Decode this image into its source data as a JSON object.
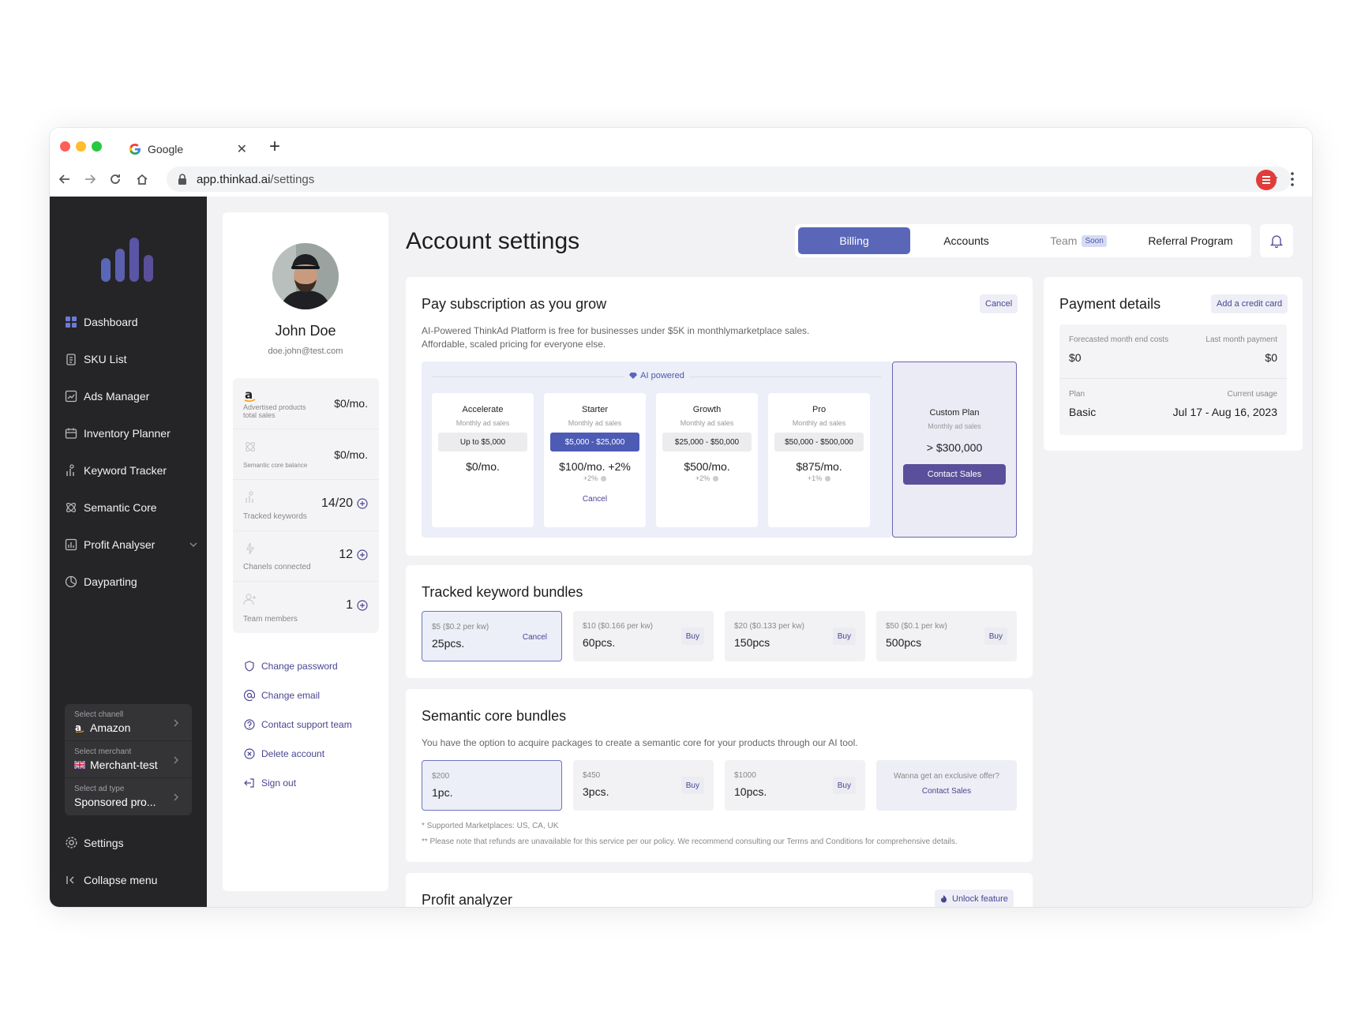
{
  "browser": {
    "tab_title": "Google",
    "url_domain": "app.thinkad.ai",
    "url_path": "/settings"
  },
  "sidebar": {
    "items": [
      {
        "label": "Dashboard",
        "icon": "dashboard-icon"
      },
      {
        "label": "SKU List",
        "icon": "clipboard-icon"
      },
      {
        "label": "Ads Manager",
        "icon": "chart-line-icon"
      },
      {
        "label": "Inventory Planner",
        "icon": "calendar-icon"
      },
      {
        "label": "Keyword Tracker",
        "icon": "keyword-icon"
      },
      {
        "label": "Semantic Core",
        "icon": "atom-icon"
      },
      {
        "label": "Profit Analyser",
        "icon": "bar-chart-icon"
      },
      {
        "label": "Dayparting",
        "icon": "clock-pie-icon"
      }
    ],
    "selectors": [
      {
        "label": "Select chanell",
        "value": "Amazon"
      },
      {
        "label": "Select merchant",
        "value": "Merchant-test"
      },
      {
        "label": "Select ad type",
        "value": "Sponsored pro..."
      }
    ],
    "settings_label": "Settings",
    "collapse_label": "Collapse menu"
  },
  "profile": {
    "name": "John Doe",
    "email": "doe.john@test.com",
    "stats": [
      {
        "label": "Advertised products total sales",
        "value": "$0/mo."
      },
      {
        "label": "Semantic core balance",
        "value": "$0/mo."
      },
      {
        "label": "Tracked keywords",
        "value": "14/20"
      },
      {
        "label": "Chanels connected",
        "value": "12"
      },
      {
        "label": "Team members",
        "value": "1"
      }
    ],
    "actions": [
      {
        "label": "Change password"
      },
      {
        "label": "Change email"
      },
      {
        "label": "Contact support team"
      },
      {
        "label": "Delete account"
      },
      {
        "label": "Sign out"
      }
    ]
  },
  "header": {
    "title": "Account settings",
    "tabs": [
      {
        "label": "Billing"
      },
      {
        "label": "Accounts"
      },
      {
        "label": "Team",
        "badge": "Soon"
      },
      {
        "label": "Referral Program"
      }
    ]
  },
  "subscription": {
    "title": "Pay subscription as you grow",
    "cancel_label": "Cancel",
    "desc_line1": "AI-Powered ThinkAd Platform is free for businesses under $5K in monthlymarketplace sales.",
    "desc_line2": "Affordable, scaled pricing for everyone else.",
    "ai_label": "AI powered",
    "plans": [
      {
        "name": "Accelerate",
        "sub": "Monthly ad sales",
        "range": "Up to $5,000",
        "price": "$0/mo.",
        "extra": ""
      },
      {
        "name": "Starter",
        "sub": "Monthly ad sales",
        "range": "$5,000 - $25,000",
        "price": "$100/mo. +2%",
        "extra": "+2%",
        "cancel": "Cancel"
      },
      {
        "name": "Growth",
        "sub": "Monthly ad sales",
        "range": "$25,000 - $50,000",
        "price": "$500/mo.",
        "extra": "+2%"
      },
      {
        "name": "Pro",
        "sub": "Monthly ad sales",
        "range": "$50,000 - $500,000",
        "price": "$875/mo.",
        "extra": "+1%"
      }
    ],
    "custom": {
      "name": "Custom Plan",
      "sub": "Monthly ad sales",
      "value": "> $300,000",
      "button": "Contact Sales"
    }
  },
  "keyword_bundles": {
    "title": "Tracked keyword bundles",
    "items": [
      {
        "sub": "$5 ($0.2 per kw)",
        "value": "25pcs.",
        "action": "Cancel"
      },
      {
        "sub": "$10 ($0.166 per kw)",
        "value": "60pcs.",
        "action": "Buy"
      },
      {
        "sub": "$20 ($0.133 per kw)",
        "value": "150pcs",
        "action": "Buy"
      },
      {
        "sub": "$50 ($0.1 per kw)",
        "value": "500pcs",
        "action": "Buy"
      }
    ]
  },
  "semantic_bundles": {
    "title": "Semantic core bundles",
    "desc": "You have the option to acquire packages to create a semantic core for your products through our AI tool.",
    "items": [
      {
        "sub": "$200",
        "value": "1pc."
      },
      {
        "sub": "$450",
        "value": "3pcs.",
        "action": "Buy"
      },
      {
        "sub": "$1000",
        "value": "10pcs.",
        "action": "Buy"
      }
    ],
    "offer_question": "Wanna get an exclusive offer?",
    "offer_link": "Contact Sales",
    "note1": "* Supported Marketplaces: US, CA, UK",
    "note2": "** Please note that refunds are unavailable for this service per our policy. We recommend consulting our Terms and Conditions for comprehensive details."
  },
  "profit": {
    "title": "Profit analyzer",
    "unlock_label": "Unlock feature"
  },
  "payment": {
    "title": "Payment details",
    "add_card_label": "Add a credit card",
    "forecast_label": "Forecasted month end costs",
    "forecast_value": "$0",
    "last_label": "Last month payment",
    "last_value": "$0",
    "plan_label": "Plan",
    "plan_value": "Basic",
    "usage_label": "Current usage",
    "usage_value": "Jul 17 - Aug 16, 2023"
  },
  "colors": {
    "accent": "#5a67b8",
    "sidebar_bg": "#252527",
    "logo_purple": "#5a4f9a"
  }
}
